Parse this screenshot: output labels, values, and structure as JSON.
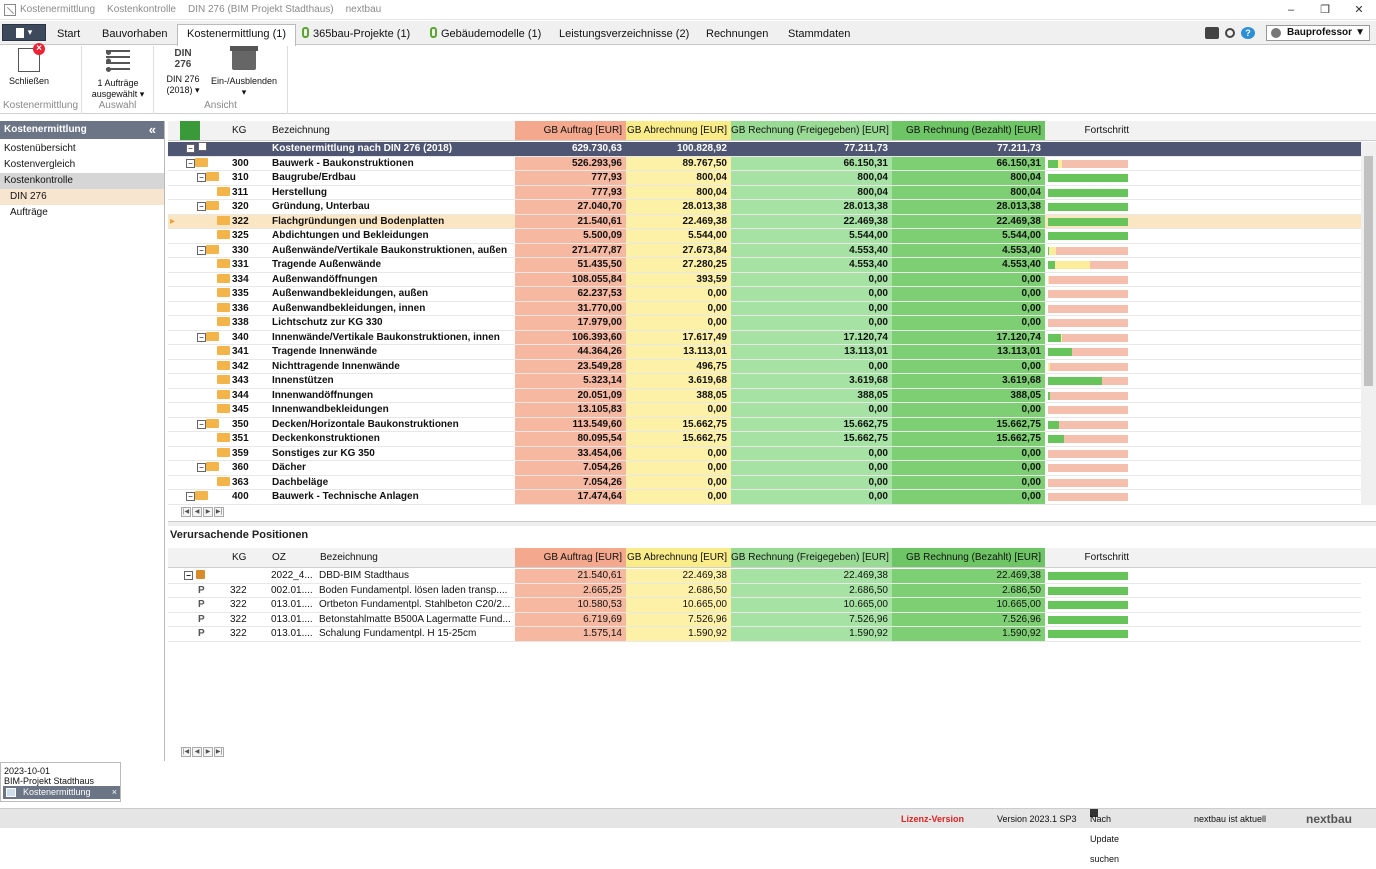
{
  "titlebar": {
    "parts": [
      "Kostenermittlung",
      "Kostenkontrolle",
      "DIN 276 (BIM Projekt Stadthaus)",
      "nextbau"
    ],
    "min": "–",
    "max": "❐",
    "close": "✕"
  },
  "menu": {
    "file": "▾",
    "tabs": [
      "Start",
      "Bauvorhaben",
      "Kostenermittlung (1)",
      "365bau-Projekte (1)",
      "Gebäudemodelle (1)",
      "Leistungsverzeichnisse (2)",
      "Rechnungen",
      "Stammdaten"
    ],
    "user": "Bauprofessor",
    "user_arrow": "▼",
    "help": "?"
  },
  "ribbon": {
    "close_label": "Schließen",
    "close_group": "Kostenermittlung",
    "orders_label1": "1 Aufträge",
    "orders_label2": "ausgewählt ▾",
    "select_group": "Auswahl",
    "din_top": "DIN",
    "din_num": "276",
    "din_label1": "DIN 276",
    "din_label2": "(2018) ▾",
    "toggle_label1": "Ein-/Ausblenden",
    "toggle_label2": "▾",
    "view_group": "Ansicht"
  },
  "sidebar": {
    "title": "Kostenermittlung",
    "collapse": "«",
    "items": [
      "Kostenübersicht",
      "Kostenvergleich",
      "Kostenkontrolle",
      "DIN 276",
      "Aufträge"
    ]
  },
  "grid": {
    "headers": {
      "kg": "KG",
      "bez": "Bezeichnung",
      "auftrag": "GB Auftrag [EUR]",
      "abr": "GB Abrechnung [EUR]",
      "frei": "GB Rechnung (Freigegeben) [EUR]",
      "bez2": "GB Rechnung (Bezahlt) [EUR]",
      "fort": "Fortschritt"
    },
    "rows": [
      {
        "kg": "",
        "bez": "Kostenermittlung nach DIN 276 (2018)",
        "a": "629.730,63",
        "b": "100.828,92",
        "c": "77.211,73",
        "d": "77.211,73"
      },
      {
        "kg": "300",
        "bez": "Bauwerk - Baukonstruktionen",
        "a": "526.293,96",
        "b": "89.767,50",
        "c": "66.150,31",
        "d": "66.150,31"
      },
      {
        "kg": "310",
        "bez": "Baugrube/Erdbau",
        "a": "777,93",
        "b": "800,04",
        "c": "800,04",
        "d": "800,04"
      },
      {
        "kg": "311",
        "bez": "Herstellung",
        "a": "777,93",
        "b": "800,04",
        "c": "800,04",
        "d": "800,04"
      },
      {
        "kg": "320",
        "bez": "Gründung, Unterbau",
        "a": "27.040,70",
        "b": "28.013,38",
        "c": "28.013,38",
        "d": "28.013,38"
      },
      {
        "kg": "322",
        "bez": "Flachgründungen und Bodenplatten",
        "a": "21.540,61",
        "b": "22.469,38",
        "c": "22.469,38",
        "d": "22.469,38"
      },
      {
        "kg": "325",
        "bez": "Abdichtungen und Bekleidungen",
        "a": "5.500,09",
        "b": "5.544,00",
        "c": "5.544,00",
        "d": "5.544,00"
      },
      {
        "kg": "330",
        "bez": "Außenwände/Vertikale Baukonstruktionen, außen",
        "a": "271.477,87",
        "b": "27.673,84",
        "c": "4.553,40",
        "d": "4.553,40"
      },
      {
        "kg": "331",
        "bez": "Tragende Außenwände",
        "a": "51.435,50",
        "b": "27.280,25",
        "c": "4.553,40",
        "d": "4.553,40"
      },
      {
        "kg": "334",
        "bez": "Außenwandöffnungen",
        "a": "108.055,84",
        "b": "393,59",
        "c": "0,00",
        "d": "0,00"
      },
      {
        "kg": "335",
        "bez": "Außenwandbekleidungen, außen",
        "a": "62.237,53",
        "b": "0,00",
        "c": "0,00",
        "d": "0,00"
      },
      {
        "kg": "336",
        "bez": "Außenwandbekleidungen, innen",
        "a": "31.770,00",
        "b": "0,00",
        "c": "0,00",
        "d": "0,00"
      },
      {
        "kg": "338",
        "bez": "Lichtschutz zur KG 330",
        "a": "17.979,00",
        "b": "0,00",
        "c": "0,00",
        "d": "0,00"
      },
      {
        "kg": "340",
        "bez": "Innenwände/Vertikale Baukonstruktionen, innen",
        "a": "106.393,60",
        "b": "17.617,49",
        "c": "17.120,74",
        "d": "17.120,74"
      },
      {
        "kg": "341",
        "bez": "Tragende Innenwände",
        "a": "44.364,26",
        "b": "13.113,01",
        "c": "13.113,01",
        "d": "13.113,01"
      },
      {
        "kg": "342",
        "bez": "Nichttragende Innenwände",
        "a": "23.549,28",
        "b": "496,75",
        "c": "0,00",
        "d": "0,00"
      },
      {
        "kg": "343",
        "bez": "Innenstützen",
        "a": "5.323,14",
        "b": "3.619,68",
        "c": "3.619,68",
        "d": "3.619,68"
      },
      {
        "kg": "344",
        "bez": "Innenwandöffnungen",
        "a": "20.051,09",
        "b": "388,05",
        "c": "388,05",
        "d": "388,05"
      },
      {
        "kg": "345",
        "bez": "Innenwandbekleidungen",
        "a": "13.105,83",
        "b": "0,00",
        "c": "0,00",
        "d": "0,00"
      },
      {
        "kg": "350",
        "bez": "Decken/Horizontale Baukonstruktionen",
        "a": "113.549,60",
        "b": "15.662,75",
        "c": "15.662,75",
        "d": "15.662,75"
      },
      {
        "kg": "351",
        "bez": "Deckenkonstruktionen",
        "a": "80.095,54",
        "b": "15.662,75",
        "c": "15.662,75",
        "d": "15.662,75"
      },
      {
        "kg": "359",
        "bez": "Sonstiges zur KG 350",
        "a": "33.454,06",
        "b": "0,00",
        "c": "0,00",
        "d": "0,00"
      },
      {
        "kg": "360",
        "bez": "Dächer",
        "a": "7.054,26",
        "b": "0,00",
        "c": "0,00",
        "d": "0,00"
      },
      {
        "kg": "363",
        "bez": "Dachbeläge",
        "a": "7.054,26",
        "b": "0,00",
        "c": "0,00",
        "d": "0,00"
      },
      {
        "kg": "400",
        "bez": "Bauwerk - Technische Anlagen",
        "a": "17.474,64",
        "b": "0,00",
        "c": "0,00",
        "d": "0,00"
      }
    ]
  },
  "positions": {
    "title": "Verursachende Positionen",
    "headers": {
      "kg": "KG",
      "oz": "OZ",
      "bez": "Bezeichnung",
      "auftrag": "GB Auftrag [EUR]",
      "abr": "GB Abrechnung [EUR]",
      "frei": "GB Rechnung (Freigegeben) [EUR]",
      "bez2": "GB Rechnung (Bezahlt) [EUR]",
      "fort": "Fortschritt"
    },
    "rows": [
      {
        "t": "",
        "kg": "",
        "oz": "2022_4...",
        "bez": "DBD-BIM Stadthaus",
        "a": "21.540,61",
        "b": "22.469,38",
        "c": "22.469,38",
        "d": "22.469,38"
      },
      {
        "t": "P",
        "kg": "322",
        "oz": "002.01....",
        "bez": "Boden Fundamentpl. lösen laden transp....",
        "a": "2.665,25",
        "b": "2.686,50",
        "c": "2.686,50",
        "d": "2.686,50"
      },
      {
        "t": "P",
        "kg": "322",
        "oz": "013.01....",
        "bez": "Ortbeton Fundamentpl. Stahlbeton C20/2...",
        "a": "10.580,53",
        "b": "10.665,00",
        "c": "10.665,00",
        "d": "10.665,00"
      },
      {
        "t": "P",
        "kg": "322",
        "oz": "013.01....",
        "bez": "Betonstahlmatte B500A Lagermatte Fund...",
        "a": "6.719,69",
        "b": "7.526,96",
        "c": "7.526,96",
        "d": "7.526,96"
      },
      {
        "t": "P",
        "kg": "322",
        "oz": "013.01....",
        "bez": "Schalung Fundamentpl. H 15-25cm",
        "a": "1.575,14",
        "b": "1.590,92",
        "c": "1.590,92",
        "d": "1.590,92"
      }
    ]
  },
  "bottomtab": {
    "date": "2023-10-01",
    "project": "BIM-Projekt Stadthaus",
    "tab": "Kostenermittlung",
    "close": "×"
  },
  "status": {
    "license": "Lizenz-Version",
    "version": "Version 2023.1 SP3",
    "update": "Nach Update suchen",
    "current": "nextbau ist aktuell",
    "logo": "nextbau"
  }
}
